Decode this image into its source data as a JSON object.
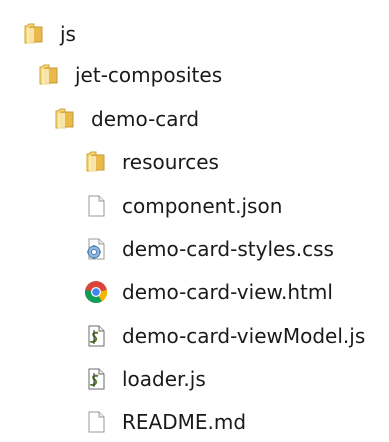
{
  "tree": {
    "items": [
      {
        "label": "js",
        "icon": "folder-icon"
      },
      {
        "label": "jet-composites",
        "icon": "folder-icon"
      },
      {
        "label": "demo-card",
        "icon": "folder-icon"
      },
      {
        "label": "resources",
        "icon": "folder-icon"
      },
      {
        "label": "component.json",
        "icon": "blank-file-icon"
      },
      {
        "label": "demo-card-styles.css",
        "icon": "css-file-icon"
      },
      {
        "label": "demo-card-view.html",
        "icon": "chrome-icon"
      },
      {
        "label": "demo-card-viewModel.js",
        "icon": "js-script-icon"
      },
      {
        "label": "loader.js",
        "icon": "js-script-icon"
      },
      {
        "label": "README.md",
        "icon": "blank-file-icon"
      }
    ]
  },
  "colors": {
    "folder_light": "#ffe9a3",
    "folder_dark": "#e0b441",
    "chrome_red": "#db4437",
    "chrome_yellow": "#f4b400",
    "chrome_green": "#0f9d58",
    "chrome_blue": "#4285f4"
  }
}
